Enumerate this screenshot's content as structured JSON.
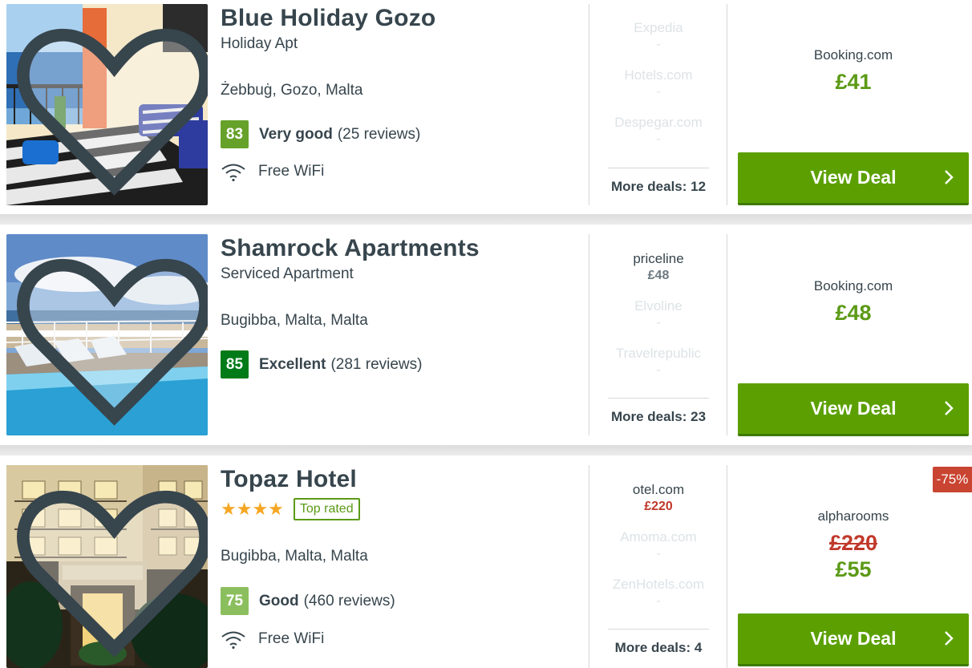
{
  "hotels": [
    {
      "name": "Blue Holiday Gozo",
      "type": "Holiday Apt",
      "location": "Żebbuġ, Gozo, Malta",
      "score": "83",
      "score_color": "#66a22a",
      "rating_word": "Very good",
      "reviews": "(25 reviews)",
      "amenity": "Free WiFi",
      "deals": [
        {
          "site": "Expedia",
          "price": "-"
        },
        {
          "site": "Hotels.com",
          "price": "-"
        },
        {
          "site": "Despegar.com",
          "price": "-"
        }
      ],
      "more_deals": "More deals: 12",
      "best_site": "Booking.com",
      "best_price": "£41",
      "button": "View Deal"
    },
    {
      "name": "Shamrock Apartments",
      "type": "Serviced Apartment",
      "location": "Bugibba, Malta, Malta",
      "score": "85",
      "score_color": "#007b18",
      "rating_word": "Excellent",
      "reviews": "(281 reviews)",
      "deals": [
        {
          "site": "priceline",
          "price": "£48"
        },
        {
          "site": "Elvoline",
          "price": "-"
        },
        {
          "site": "Travelrepublic",
          "price": "-"
        }
      ],
      "more_deals": "More deals: 23",
      "best_site": "Booking.com",
      "best_price": "£48",
      "button": "View Deal"
    },
    {
      "name": "Topaz Hotel",
      "stars": "★★★★",
      "badge": "Top rated",
      "location": "Bugibba, Malta, Malta",
      "score": "75",
      "score_color": "#8bbf5e",
      "rating_word": "Good",
      "reviews": "(460 reviews)",
      "amenity": "Free WiFi",
      "deals": [
        {
          "site": "otel.com",
          "price": "£220"
        },
        {
          "site": "Amoma.com",
          "price": "-"
        },
        {
          "site": "ZenHotels.com",
          "price": "-"
        }
      ],
      "more_deals": "More deals: 4",
      "best_site": "alpharooms",
      "old_price": "£220",
      "best_price": "£55",
      "discount": "-75%",
      "button": "View Deal"
    }
  ],
  "colors": {
    "accent_green": "#5ba000",
    "price_green": "#5b9a16",
    "discount_red": "#c94431",
    "text": "#37454d"
  }
}
